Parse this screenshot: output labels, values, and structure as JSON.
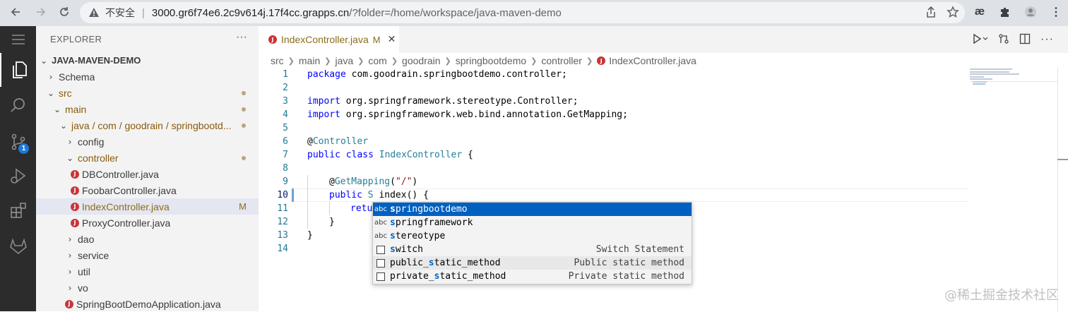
{
  "browser": {
    "insecure_label": "不安全",
    "url_host": "3000.gr6f74e6.2c9v614j.17f4cc.grapps.cn",
    "url_path": "/?folder=/home/workspace/java-maven-demo"
  },
  "activity": {
    "source_control_badge": "1"
  },
  "sidebar": {
    "title": "EXPLORER",
    "more": "···",
    "tree": [
      {
        "label": "JAVA-MAVEN-DEMO",
        "chev": "⌄",
        "level": 0
      },
      {
        "label": "Schema",
        "chev": "›",
        "level": 1
      },
      {
        "label": "src",
        "chev": "⌄",
        "level": 1
      },
      {
        "label": "main",
        "chev": "⌄",
        "level": 2
      },
      {
        "label": "java / com / goodrain / springbootd...",
        "chev": "⌄",
        "level": 3
      },
      {
        "label": "config",
        "chev": "›",
        "level": 4
      },
      {
        "label": "controller",
        "chev": "⌄",
        "level": 4
      },
      {
        "label": "DBController.java",
        "level": 5
      },
      {
        "label": "FoobarController.java",
        "level": 5
      },
      {
        "label": "IndexController.java",
        "level": 5,
        "status": "M"
      },
      {
        "label": "ProxyController.java",
        "level": 5
      },
      {
        "label": "dao",
        "chev": "›",
        "level": 4
      },
      {
        "label": "service",
        "chev": "›",
        "level": 4
      },
      {
        "label": "util",
        "chev": "›",
        "level": 4
      },
      {
        "label": "vo",
        "chev": "›",
        "level": 4
      },
      {
        "label": "SpringBootDemoApplication.java",
        "level": 4
      }
    ]
  },
  "editor": {
    "tab_label": "IndexController.java",
    "tab_status": "M",
    "tab_close": "✕",
    "breadcrumb": [
      "src",
      "main",
      "java",
      "com",
      "goodrain",
      "springbootdemo",
      "controller",
      "IndexController.java"
    ],
    "line_numbers": [
      "1",
      "2",
      "3",
      "4",
      "5",
      "6",
      "7",
      "8",
      "9",
      "10",
      "11",
      "12",
      "13",
      "14"
    ],
    "code": {
      "l1": "package com.goodrain.springbootdemo.controller;",
      "l3_kw": "import",
      "l3_rest": " org.springframework.stereotype.Controller;",
      "l4_kw": "import",
      "l4_rest": " org.springframework.web.bind.annotation.GetMapping;",
      "l6_at": "@",
      "l6_ann": "Controller",
      "l7_kw1": "public",
      "l7_kw2": "class",
      "l7_ty": "IndexController",
      "l7_rest": " {",
      "l9_at": "@",
      "l9_ann": "GetMapping",
      "l9_p1": "(",
      "l9_str": "\"/\"",
      "l9_p2": ")",
      "l10_kw": "public",
      "l10_ty": "S",
      "l10_rest": " index() {",
      "l11_kw": "retu",
      "l12": "}",
      "l13": "}"
    }
  },
  "suggest": [
    {
      "icon": "abc",
      "pre": "",
      "match": "s",
      "rest": "pringbootdemo",
      "detail": "",
      "selected": true
    },
    {
      "icon": "abc",
      "pre": "",
      "match": "s",
      "rest": "pringframework",
      "detail": ""
    },
    {
      "icon": "abc",
      "pre": "",
      "match": "s",
      "rest": "tereotype",
      "detail": ""
    },
    {
      "icon": "snippet",
      "pre": "",
      "match": "s",
      "rest": "witch",
      "detail": "Switch Statement"
    },
    {
      "icon": "snippet",
      "pre": "public_",
      "match": "s",
      "rest": "tatic_method",
      "detail": "Public static method"
    },
    {
      "icon": "snippet",
      "pre": "private_",
      "match": "s",
      "rest": "tatic_method",
      "detail": "Private static method"
    }
  ],
  "watermark": "@稀土掘金技术社区"
}
